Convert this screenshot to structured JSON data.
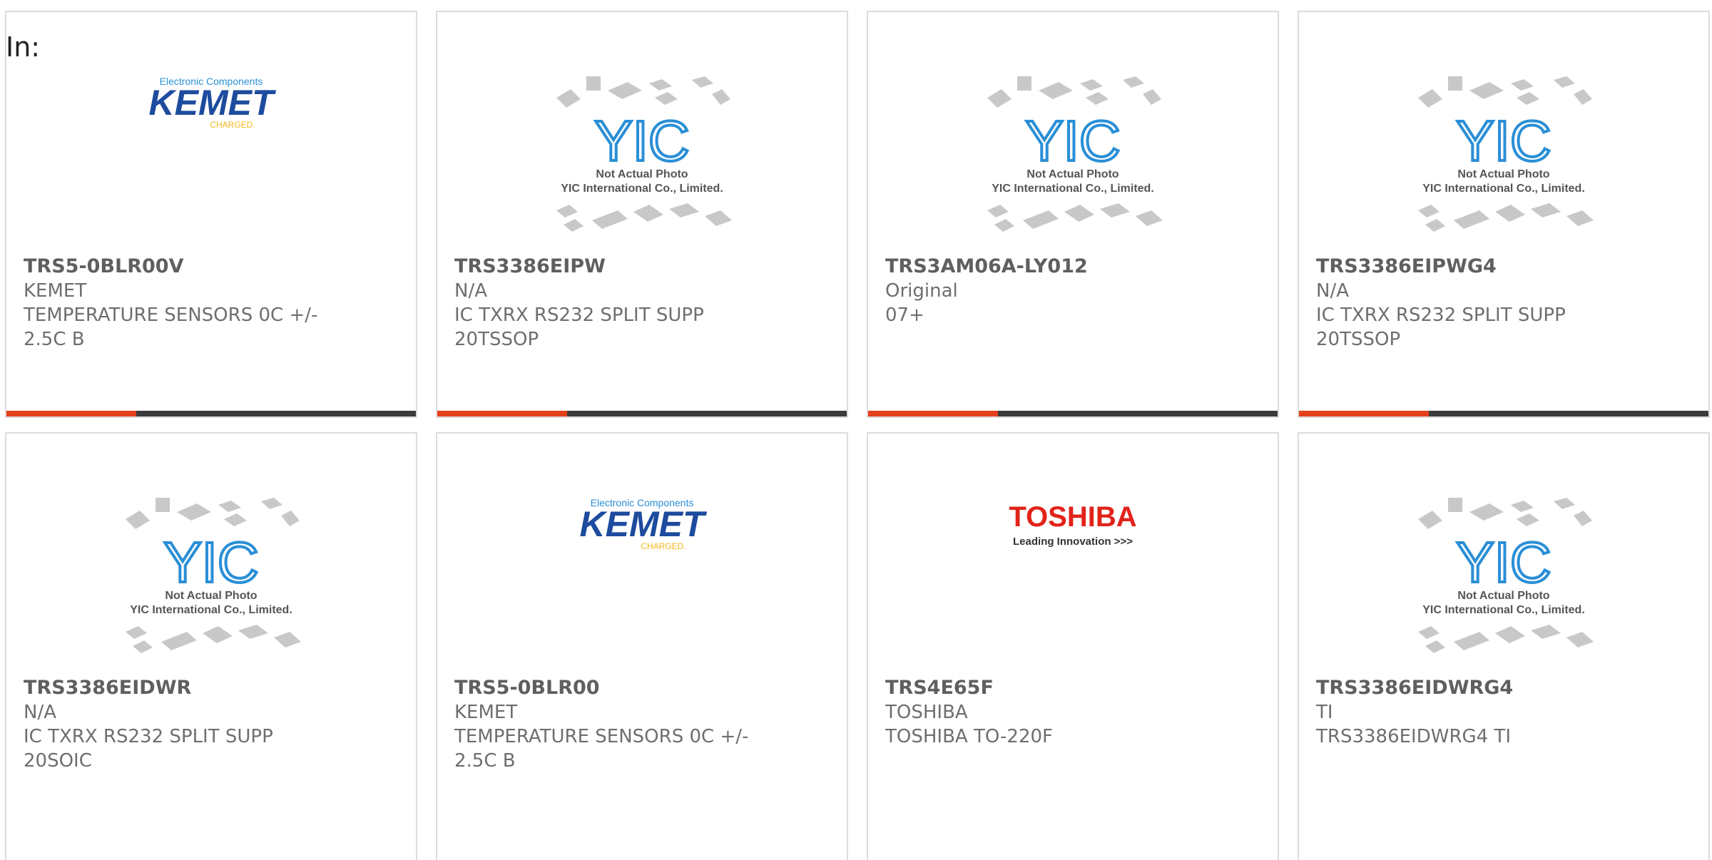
{
  "page": {
    "label": "In:"
  },
  "colors": {
    "accent": "#e5401c",
    "bar_dark": "#3b3b3b",
    "card_border": "#dcdcdc"
  },
  "products": [
    {
      "part": "TRS5-0BLR00V",
      "maker": "KEMET",
      "desc": "TEMPERATURE SENSORS 0C +/- 2.5C B",
      "image": "kemet-logo"
    },
    {
      "part": "TRS3386EIPW",
      "maker": "N/A",
      "desc": "IC TXRX RS232 SPLIT SUPP 20TSSOP",
      "image": "yic-placeholder"
    },
    {
      "part": "TRS3AM06A-LY012",
      "maker": "Original",
      "desc": "07+",
      "image": "yic-placeholder"
    },
    {
      "part": "TRS3386EIPWG4",
      "maker": "N/A",
      "desc": "IC TXRX RS232 SPLIT SUPP 20TSSOP",
      "image": "yic-placeholder"
    },
    {
      "part": "TRS3386EIDWR",
      "maker": "N/A",
      "desc": "IC TXRX RS232 SPLIT SUPP 20SOIC",
      "image": "yic-placeholder"
    },
    {
      "part": "TRS5-0BLR00",
      "maker": "KEMET",
      "desc": "TEMPERATURE SENSORS 0C +/- 2.5C B",
      "image": "kemet-logo"
    },
    {
      "part": "TRS4E65F",
      "maker": "TOSHIBA",
      "desc": "TOSHIBA TO-220F",
      "image": "toshiba-logo"
    },
    {
      "part": "TRS3386EIDWRG4",
      "maker": "TI",
      "desc": "TRS3386EIDWRG4 TI",
      "image": "yic-placeholder"
    }
  ],
  "logos": {
    "kemet": {
      "tagline": "Electronic Components",
      "name": "KEMET",
      "sub": "CHARGED."
    },
    "yic": {
      "mark": "YIC",
      "line1": "Not Actual Photo",
      "line2": "YIC International Co., Limited."
    },
    "toshiba": {
      "name": "TOSHIBA",
      "tagline": "Leading Innovation >>>"
    }
  }
}
